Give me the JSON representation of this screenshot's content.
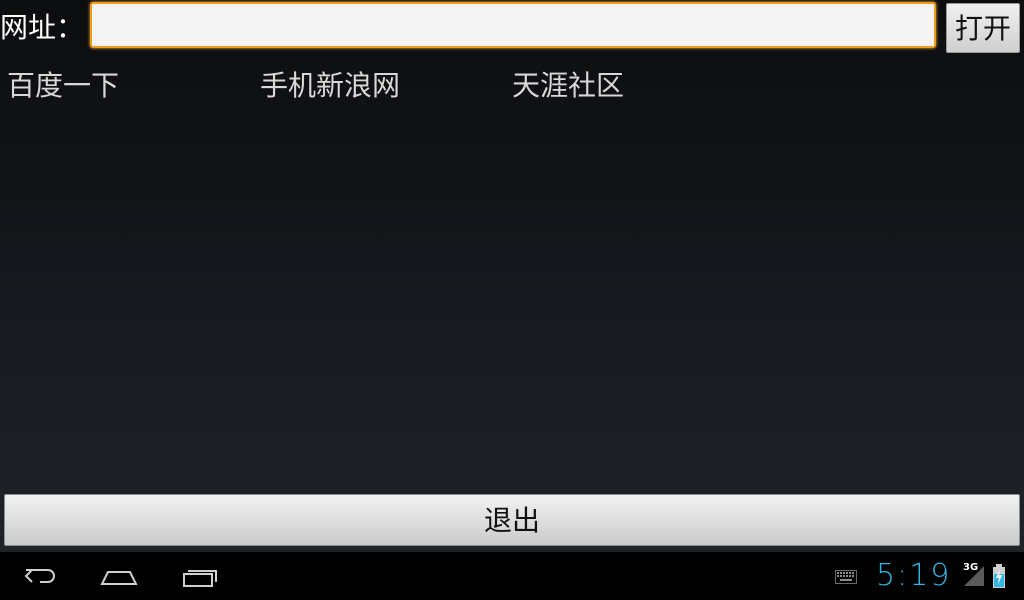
{
  "url_bar": {
    "label": "网址：",
    "value": "",
    "placeholder": "",
    "open_button": "打开"
  },
  "links": [
    {
      "label": "百度一下"
    },
    {
      "label": "手机新浪网"
    },
    {
      "label": "天涯社区"
    }
  ],
  "exit_button": "退出",
  "status_bar": {
    "time": "5:19",
    "network": "3G",
    "accent_color": "#33b5e5",
    "focus_color": "#f39b1c"
  },
  "nav_icons": [
    "back-icon",
    "home-icon",
    "recent-apps-icon"
  ]
}
